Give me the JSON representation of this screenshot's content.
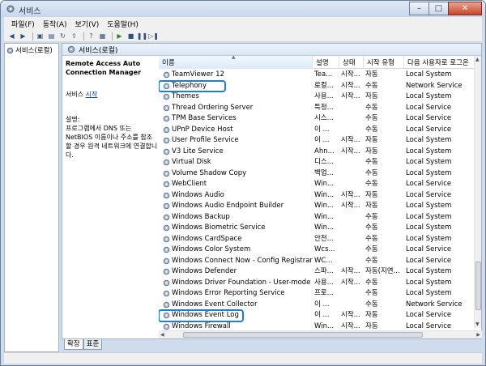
{
  "window": {
    "title": "서비스"
  },
  "menu": [
    "파일(F)",
    "동작(A)",
    "보기(V)",
    "도움말(H)"
  ],
  "tree": {
    "root_label": "서비스(로컬)"
  },
  "pane": {
    "header": "서비스(로컬)"
  },
  "detail": {
    "service_name": "Remote Access Auto Connection Manager",
    "service_prefix": "서비스 ",
    "start_link": "시작",
    "desc_label": "설명:",
    "desc_text": "프로그램에서 DNS 또는 NetBIOS 이름이나 주소를 참조할 경우 원격 네트워크에 연결합니다."
  },
  "columns": [
    "이름",
    "설명",
    "상태",
    "시작 유형",
    "다음 사용자로 로그온"
  ],
  "services": [
    {
      "name": "TeamViewer 12",
      "desc": "Tea...",
      "status": "시작...",
      "start": "자동",
      "logon": "Local System",
      "highlight": false
    },
    {
      "name": "Telephony",
      "desc": "로컬...",
      "status": "시작...",
      "start": "수동",
      "logon": "Network Service",
      "highlight": true
    },
    {
      "name": "Themes",
      "desc": "사용...",
      "status": "시작...",
      "start": "자동",
      "logon": "Local System",
      "highlight": false
    },
    {
      "name": "Thread Ordering Server",
      "desc": "특정...",
      "status": "",
      "start": "수동",
      "logon": "Local Service",
      "highlight": false
    },
    {
      "name": "TPM Base Services",
      "desc": "시스...",
      "status": "",
      "start": "수동",
      "logon": "Local Service",
      "highlight": false
    },
    {
      "name": "UPnP Device Host",
      "desc": "이 ...",
      "status": "",
      "start": "수동",
      "logon": "Local Service",
      "highlight": false
    },
    {
      "name": "User Profile Service",
      "desc": "이 ...",
      "status": "시작...",
      "start": "자동",
      "logon": "Local System",
      "highlight": false
    },
    {
      "name": "V3 Lite Service",
      "desc": "Ahn...",
      "status": "시작...",
      "start": "자동",
      "logon": "Local System",
      "highlight": false
    },
    {
      "name": "Virtual Disk",
      "desc": "디스...",
      "status": "",
      "start": "수동",
      "logon": "Local System",
      "highlight": false
    },
    {
      "name": "Volume Shadow Copy",
      "desc": "백업...",
      "status": "",
      "start": "수동",
      "logon": "Local System",
      "highlight": false
    },
    {
      "name": "WebClient",
      "desc": "Win...",
      "status": "",
      "start": "수동",
      "logon": "Local Service",
      "highlight": false
    },
    {
      "name": "Windows Audio",
      "desc": "Win...",
      "status": "시작...",
      "start": "자동",
      "logon": "Local Service",
      "highlight": false
    },
    {
      "name": "Windows Audio Endpoint Builder",
      "desc": "Win...",
      "status": "시작...",
      "start": "자동",
      "logon": "Local System",
      "highlight": false
    },
    {
      "name": "Windows Backup",
      "desc": "Win...",
      "status": "",
      "start": "수동",
      "logon": "Local System",
      "highlight": false
    },
    {
      "name": "Windows Biometric Service",
      "desc": "Win...",
      "status": "",
      "start": "수동",
      "logon": "Local System",
      "highlight": false
    },
    {
      "name": "Windows CardSpace",
      "desc": "안전...",
      "status": "",
      "start": "수동",
      "logon": "Local System",
      "highlight": false
    },
    {
      "name": "Windows Color System",
      "desc": "Wcs...",
      "status": "",
      "start": "수동",
      "logon": "Local Service",
      "highlight": false
    },
    {
      "name": "Windows Connect Now - Config Registrar",
      "desc": "WC...",
      "status": "",
      "start": "수동",
      "logon": "Local Service",
      "highlight": false
    },
    {
      "name": "Windows Defender",
      "desc": "스파...",
      "status": "시작...",
      "start": "자동(지연...",
      "logon": "Local System",
      "highlight": false
    },
    {
      "name": "Windows Driver Foundation - User-mode D...",
      "desc": "사용...",
      "status": "시작...",
      "start": "수동",
      "logon": "Local System",
      "highlight": false
    },
    {
      "name": "Windows Error Reporting Service",
      "desc": "프로...",
      "status": "",
      "start": "수동",
      "logon": "Local System",
      "highlight": false
    },
    {
      "name": "Windows Event Collector",
      "desc": "이 ...",
      "status": "",
      "start": "수동",
      "logon": "Network Service",
      "highlight": false
    },
    {
      "name": "Windows Event Log",
      "desc": "이 ...",
      "status": "시작...",
      "start": "자동",
      "logon": "Local Service",
      "highlight": true
    },
    {
      "name": "Windows Firewall",
      "desc": "Win...",
      "status": "시작...",
      "start": "자동",
      "logon": "Local Service",
      "highlight": false
    }
  ],
  "tabs": [
    "확장",
    "표준"
  ]
}
